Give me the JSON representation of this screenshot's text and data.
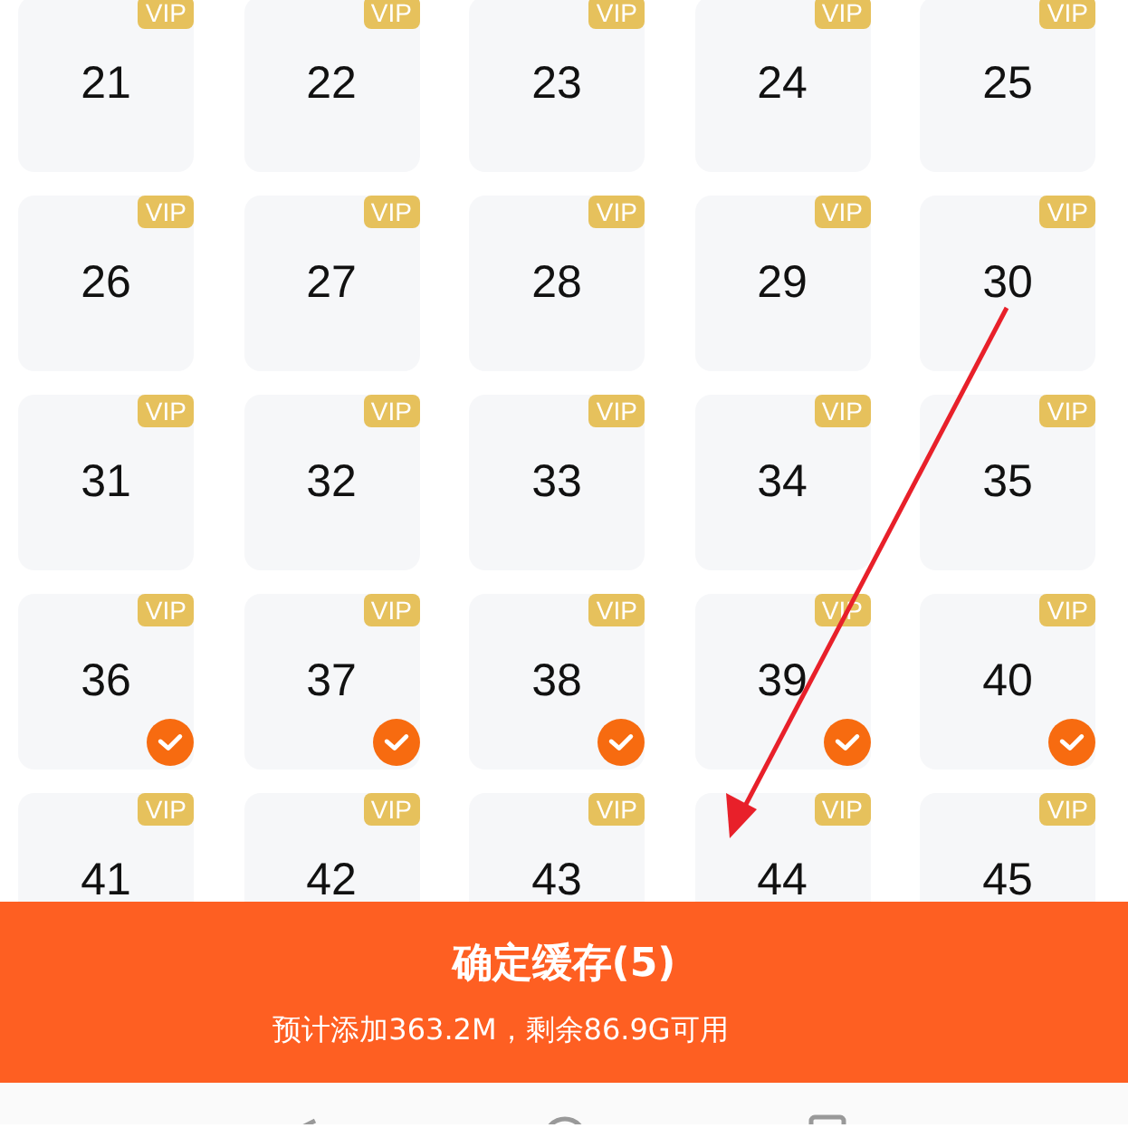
{
  "episodes": [
    {
      "number": "21",
      "badge": "VIP",
      "selected": false
    },
    {
      "number": "22",
      "badge": "VIP",
      "selected": false
    },
    {
      "number": "23",
      "badge": "VIP",
      "selected": false
    },
    {
      "number": "24",
      "badge": "VIP",
      "selected": false
    },
    {
      "number": "25",
      "badge": "VIP",
      "selected": false
    },
    {
      "number": "26",
      "badge": "VIP",
      "selected": false
    },
    {
      "number": "27",
      "badge": "VIP",
      "selected": false
    },
    {
      "number": "28",
      "badge": "VIP",
      "selected": false
    },
    {
      "number": "29",
      "badge": "VIP",
      "selected": false
    },
    {
      "number": "30",
      "badge": "VIP",
      "selected": false
    },
    {
      "number": "31",
      "badge": "VIP",
      "selected": false
    },
    {
      "number": "32",
      "badge": "VIP",
      "selected": false
    },
    {
      "number": "33",
      "badge": "VIP",
      "selected": false
    },
    {
      "number": "34",
      "badge": "VIP",
      "selected": false
    },
    {
      "number": "35",
      "badge": "VIP",
      "selected": false
    },
    {
      "number": "36",
      "badge": "VIP",
      "selected": true
    },
    {
      "number": "37",
      "badge": "VIP",
      "selected": true
    },
    {
      "number": "38",
      "badge": "VIP",
      "selected": true
    },
    {
      "number": "39",
      "badge": "VIP",
      "selected": true
    },
    {
      "number": "40",
      "badge": "VIP",
      "selected": true
    },
    {
      "number": "41",
      "badge": "VIP",
      "selected": false
    },
    {
      "number": "42",
      "badge": "VIP",
      "selected": false
    },
    {
      "number": "43",
      "badge": "VIP",
      "selected": false
    },
    {
      "number": "44",
      "badge": "VIP",
      "selected": false
    },
    {
      "number": "45",
      "badge": "VIP",
      "selected": false
    }
  ],
  "confirm_button": {
    "label": "确定缓存(5)",
    "info": "预计添加363.2M，剩余86.9G可用"
  }
}
